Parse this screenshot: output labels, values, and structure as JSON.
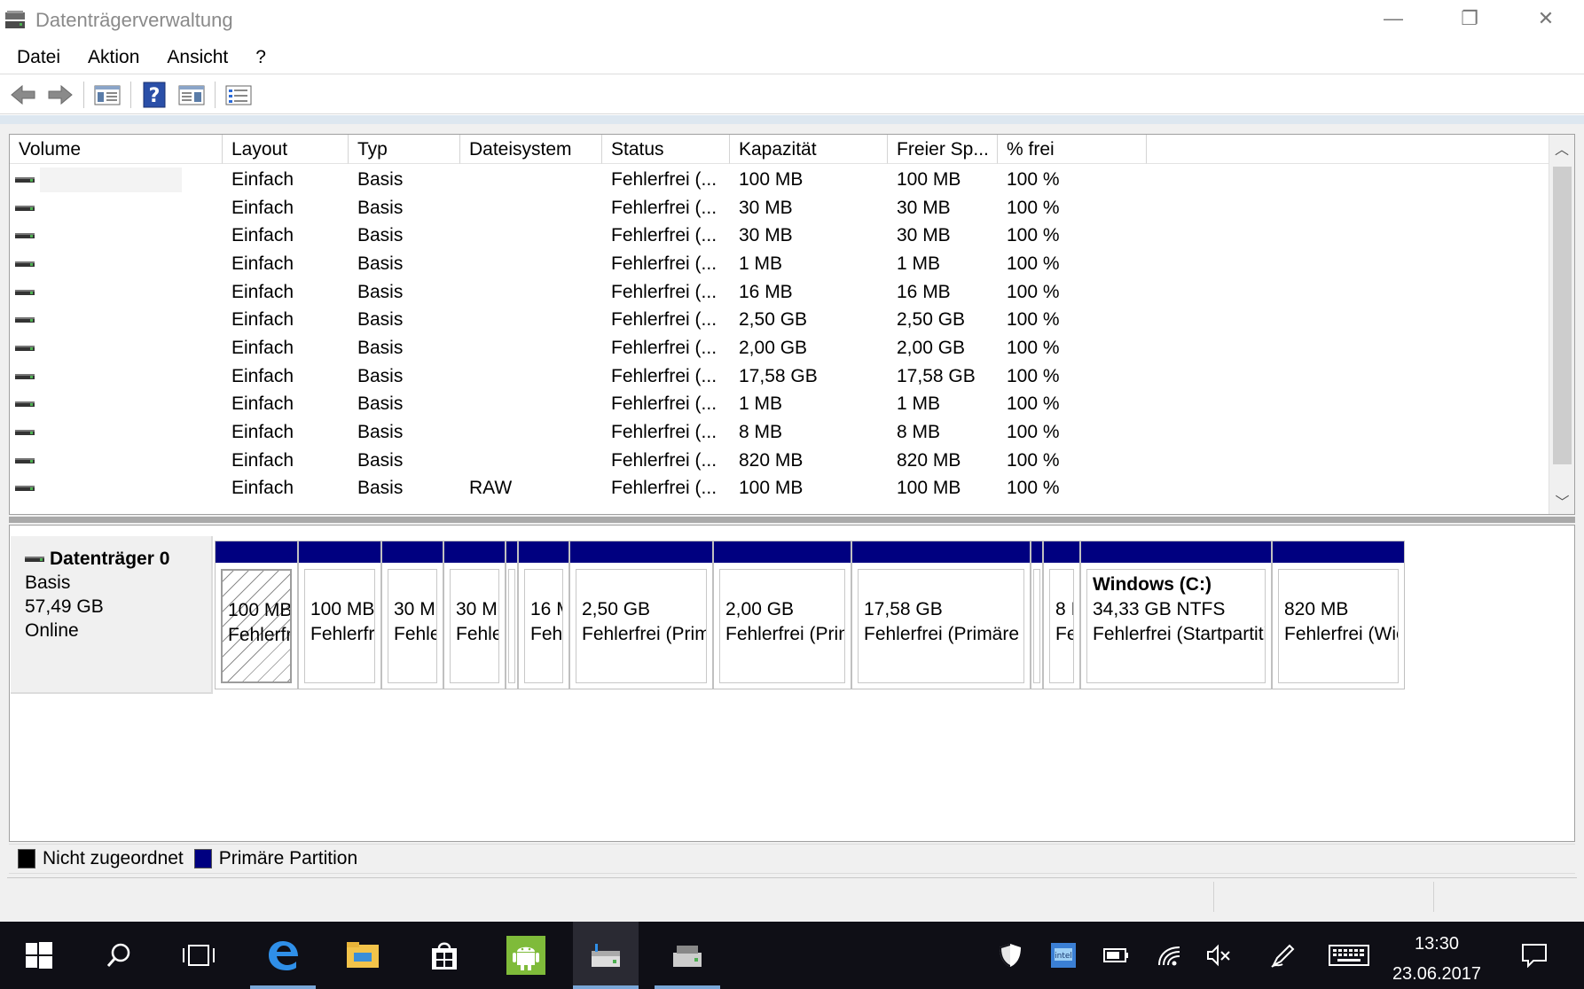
{
  "window": {
    "title": "Datenträgerverwaltung",
    "minimize": "—",
    "restore": "❐",
    "close": "✕"
  },
  "menu": [
    "Datei",
    "Aktion",
    "Ansicht",
    "?"
  ],
  "toolbar": {
    "icons": [
      "back-arrow-icon",
      "forward-arrow-icon",
      "show-hide-tree-icon",
      "help-icon",
      "properties-icon",
      "disk-list-icon"
    ]
  },
  "volume_list": {
    "columns": [
      "Volume",
      "Layout",
      "Typ",
      "Dateisystem",
      "Status",
      "Kapazität",
      "Freier Sp...",
      "% frei"
    ],
    "rows": [
      {
        "volume": "",
        "layout": "Einfach",
        "typ": "Basis",
        "fs": "",
        "status": "Fehlerfrei (...",
        "cap": "100 MB",
        "free": "100 MB",
        "pct": "100 %"
      },
      {
        "volume": "",
        "layout": "Einfach",
        "typ": "Basis",
        "fs": "",
        "status": "Fehlerfrei (...",
        "cap": "30 MB",
        "free": "30 MB",
        "pct": "100 %"
      },
      {
        "volume": "",
        "layout": "Einfach",
        "typ": "Basis",
        "fs": "",
        "status": "Fehlerfrei (...",
        "cap": "30 MB",
        "free": "30 MB",
        "pct": "100 %"
      },
      {
        "volume": "",
        "layout": "Einfach",
        "typ": "Basis",
        "fs": "",
        "status": "Fehlerfrei (...",
        "cap": "1 MB",
        "free": "1 MB",
        "pct": "100 %"
      },
      {
        "volume": "",
        "layout": "Einfach",
        "typ": "Basis",
        "fs": "",
        "status": "Fehlerfrei (...",
        "cap": "16 MB",
        "free": "16 MB",
        "pct": "100 %"
      },
      {
        "volume": "",
        "layout": "Einfach",
        "typ": "Basis",
        "fs": "",
        "status": "Fehlerfrei (...",
        "cap": "2,50 GB",
        "free": "2,50 GB",
        "pct": "100 %"
      },
      {
        "volume": "",
        "layout": "Einfach",
        "typ": "Basis",
        "fs": "",
        "status": "Fehlerfrei (...",
        "cap": "2,00 GB",
        "free": "2,00 GB",
        "pct": "100 %"
      },
      {
        "volume": "",
        "layout": "Einfach",
        "typ": "Basis",
        "fs": "",
        "status": "Fehlerfrei (...",
        "cap": "17,58 GB",
        "free": "17,58 GB",
        "pct": "100 %"
      },
      {
        "volume": "",
        "layout": "Einfach",
        "typ": "Basis",
        "fs": "",
        "status": "Fehlerfrei (...",
        "cap": "1 MB",
        "free": "1 MB",
        "pct": "100 %"
      },
      {
        "volume": "",
        "layout": "Einfach",
        "typ": "Basis",
        "fs": "",
        "status": "Fehlerfrei (...",
        "cap": "8 MB",
        "free": "8 MB",
        "pct": "100 %"
      },
      {
        "volume": "",
        "layout": "Einfach",
        "typ": "Basis",
        "fs": "",
        "status": "Fehlerfrei (...",
        "cap": "820 MB",
        "free": "820 MB",
        "pct": "100 %"
      },
      {
        "volume": "",
        "layout": "Einfach",
        "typ": "Basis",
        "fs": "RAW",
        "status": "Fehlerfrei (...",
        "cap": "100 MB",
        "free": "100 MB",
        "pct": "100 %"
      }
    ]
  },
  "disk": {
    "name": "Datenträger 0",
    "type": "Basis",
    "size": "57,49 GB",
    "state": "Online"
  },
  "partitions": [
    {
      "name": "",
      "line1": "100 MB",
      "line2": "Fehlerfrei",
      "hatched": true
    },
    {
      "name": "",
      "line1": "100 MB",
      "line2": "Fehlerfrei",
      "hatched": false
    },
    {
      "name": "",
      "line1": "30 M",
      "line2": "Fehle",
      "hatched": false
    },
    {
      "name": "",
      "line1": "30 M",
      "line2": "Fehle",
      "hatched": false
    },
    {
      "name": "",
      "line1": "",
      "line2": "",
      "hatched": false
    },
    {
      "name": "",
      "line1": "16 M",
      "line2": "Feh",
      "hatched": false
    },
    {
      "name": "",
      "line1": "2,50 GB",
      "line2": "Fehlerfrei (Primä",
      "hatched": false
    },
    {
      "name": "",
      "line1": "2,00 GB",
      "line2": "Fehlerfrei (Prim",
      "hatched": false
    },
    {
      "name": "",
      "line1": "17,58 GB",
      "line2": "Fehlerfrei (Primäre P",
      "hatched": false
    },
    {
      "name": "",
      "line1": "",
      "line2": "",
      "hatched": false
    },
    {
      "name": "",
      "line1": "8 I",
      "line2": "Fe",
      "hatched": false
    },
    {
      "name": "Windows  (C:)",
      "line1": "34,33 GB NTFS",
      "line2": "Fehlerfrei (Startpartitic",
      "hatched": false
    },
    {
      "name": "",
      "line1": "820 MB",
      "line2": "Fehlerfrei (Wie",
      "hatched": false
    }
  ],
  "legend": {
    "unallocated": "Nicht zugeordnet",
    "primary": "Primäre Partition",
    "unallocated_color": "#000000",
    "primary_color": "#000080"
  },
  "taskbar": {
    "apps": [
      "start-icon",
      "search-icon",
      "task-view-icon",
      "edge-icon",
      "file-explorer-icon",
      "store-icon",
      "android-icon",
      "disk-management-icon",
      "app-icon"
    ],
    "time": "13:30",
    "date": "23.06.2017"
  }
}
